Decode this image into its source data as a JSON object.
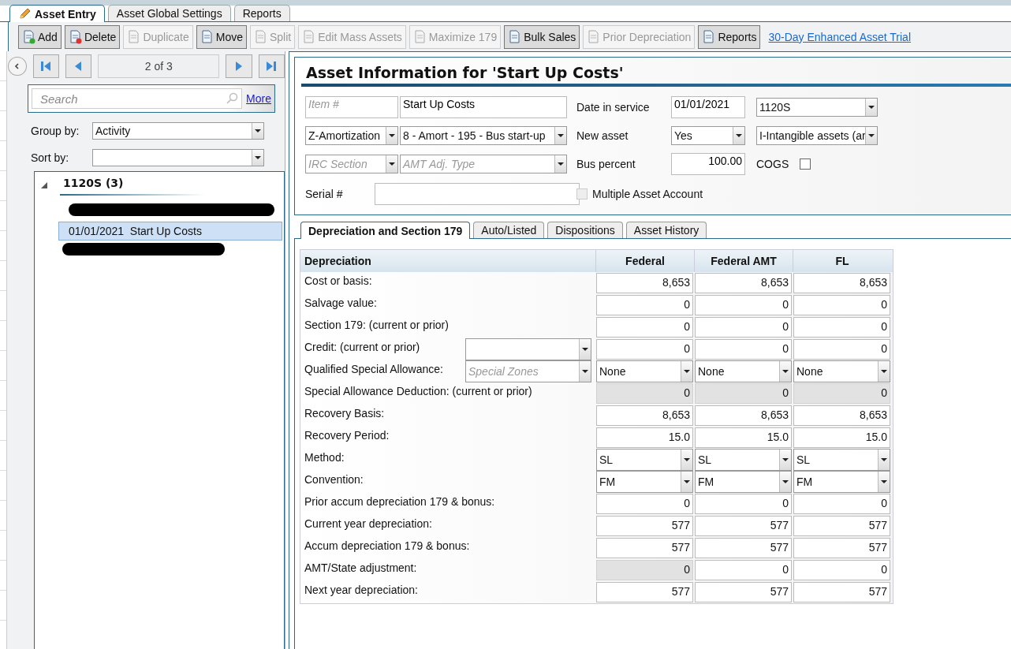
{
  "main_tabs": [
    {
      "label": "Asset Entry",
      "selected": true,
      "icon": true
    },
    {
      "label": "Asset Global Settings",
      "selected": false,
      "icon": false
    },
    {
      "label": "Reports",
      "selected": false,
      "icon": false
    }
  ],
  "toolbar": [
    {
      "label": "Add",
      "disabled": false,
      "pressed": true
    },
    {
      "label": "Delete",
      "disabled": false,
      "pressed": true
    },
    {
      "label": "Duplicate",
      "disabled": true,
      "pressed": false
    },
    {
      "label": "Move",
      "disabled": false,
      "pressed": true
    },
    {
      "label": "Split",
      "disabled": true,
      "pressed": false
    },
    {
      "label": "Edit Mass Assets",
      "disabled": true,
      "pressed": false
    },
    {
      "label": "Maximize 179",
      "disabled": true,
      "pressed": false
    },
    {
      "label": "Bulk Sales",
      "disabled": false,
      "pressed": true
    },
    {
      "label": "Prior Depreciation",
      "disabled": true,
      "pressed": false
    },
    {
      "label": "Reports",
      "disabled": false,
      "pressed": true
    }
  ],
  "trial_link": "30-Day Enhanced Asset Trial",
  "navigator": {
    "position": "2 of 3"
  },
  "search": {
    "placeholder": "Search",
    "more_link": "More"
  },
  "group_by": {
    "label": "Group by:",
    "value": "Activity"
  },
  "sort_by": {
    "label": "Sort by:"
  },
  "tree": [
    {
      "label": "1120S (3)",
      "expanded": true,
      "children": [
        {
          "redacted": true
        },
        {
          "label": "01/01/2021  Start Up Costs",
          "selected": true
        },
        {
          "redacted": true
        }
      ]
    }
  ],
  "asset": {
    "title": "Asset Information for 'Start Up Costs'",
    "item_number": {
      "placeholder": "Item #"
    },
    "description": {
      "value": "Start Up Costs"
    },
    "date_in_service": {
      "label": "Date in service",
      "value": "01/01/2021"
    },
    "return_type": {
      "value": "1120S"
    },
    "category": {
      "value": "Z-Amortization"
    },
    "code": {
      "value": "8 - Amort - 195 - Bus start-up"
    },
    "new_asset": {
      "label": "New asset",
      "value": "Yes"
    },
    "asset_type": {
      "value": "I-Intangible assets (ar"
    },
    "irc_section": {
      "placeholder": "IRC Section"
    },
    "amt_adj_type": {
      "placeholder": "AMT Adj. Type"
    },
    "bus_percent": {
      "label": "Bus percent",
      "value": "100.00"
    },
    "cogs": {
      "label": "COGS",
      "checked": false
    },
    "serial": {
      "label": "Serial #"
    },
    "multiple_asset_account": {
      "label": "Multiple Asset Account",
      "checked": false,
      "disabled": true
    }
  },
  "detail_tabs": [
    {
      "label": "Depreciation and Section 179",
      "selected": true
    },
    {
      "label": "Auto/Listed",
      "selected": false
    },
    {
      "label": "Dispositions",
      "selected": false
    },
    {
      "label": "Asset History",
      "selected": false
    }
  ],
  "table": {
    "columns": [
      "Depreciation",
      "Federal",
      "Federal AMT",
      "FL"
    ],
    "rows": [
      {
        "label": "Cost or basis:",
        "kind": "input",
        "cells": [
          {
            "value": "8,653",
            "readonly": false
          },
          {
            "value": "8,653",
            "readonly": false
          },
          {
            "value": "8,653",
            "readonly": false
          }
        ]
      },
      {
        "label": "Salvage value:",
        "kind": "input",
        "cells": [
          {
            "value": "0",
            "readonly": false
          },
          {
            "value": "0",
            "readonly": false
          },
          {
            "value": "0",
            "readonly": false
          }
        ]
      },
      {
        "label": "Section 179: (current or prior)",
        "kind": "input",
        "cells": [
          {
            "value": "0",
            "readonly": false
          },
          {
            "value": "0",
            "readonly": false
          },
          {
            "value": "0",
            "readonly": false
          }
        ]
      },
      {
        "label": "Credit: (current or prior)",
        "kind": "input",
        "extra": {
          "kind": "dropdown"
        },
        "cells": [
          {
            "value": "0",
            "readonly": false
          },
          {
            "value": "0",
            "readonly": false
          },
          {
            "value": "0",
            "readonly": false
          }
        ]
      },
      {
        "label": "Qualified Special Allowance:",
        "kind": "select",
        "extra": {
          "kind": "dropdown",
          "placeholder": "Special Zones"
        },
        "cells": [
          {
            "value": "None"
          },
          {
            "value": "None"
          },
          {
            "value": "None"
          }
        ]
      },
      {
        "label": "Special Allowance Deduction: (current or prior)",
        "kind": "input",
        "cells": [
          {
            "value": "0",
            "readonly": true
          },
          {
            "value": "0",
            "readonly": true
          },
          {
            "value": "0",
            "readonly": true
          }
        ]
      },
      {
        "label": "Recovery Basis:",
        "kind": "input",
        "cells": [
          {
            "value": "8,653",
            "readonly": false
          },
          {
            "value": "8,653",
            "readonly": false
          },
          {
            "value": "8,653",
            "readonly": false
          }
        ]
      },
      {
        "label": "Recovery Period:",
        "kind": "input",
        "cells": [
          {
            "value": "15.0",
            "readonly": false
          },
          {
            "value": "15.0",
            "readonly": false
          },
          {
            "value": "15.0",
            "readonly": false
          }
        ]
      },
      {
        "label": "Method:",
        "kind": "select",
        "cells": [
          {
            "value": "SL"
          },
          {
            "value": "SL"
          },
          {
            "value": "SL"
          }
        ]
      },
      {
        "label": "Convention:",
        "kind": "select",
        "cells": [
          {
            "value": "FM"
          },
          {
            "value": "FM"
          },
          {
            "value": "FM"
          }
        ]
      },
      {
        "label": "Prior accum depreciation 179 & bonus:",
        "kind": "input",
        "cells": [
          {
            "value": "0",
            "readonly": false
          },
          {
            "value": "0",
            "readonly": false
          },
          {
            "value": "0",
            "readonly": false
          }
        ]
      },
      {
        "label": "Current year depreciation:",
        "kind": "input",
        "cells": [
          {
            "value": "577",
            "readonly": false
          },
          {
            "value": "577",
            "readonly": false
          },
          {
            "value": "577",
            "readonly": false
          }
        ]
      },
      {
        "label": "Accum depreciation 179 & bonus:",
        "kind": "input",
        "cells": [
          {
            "value": "577",
            "readonly": false
          },
          {
            "value": "577",
            "readonly": false
          },
          {
            "value": "577",
            "readonly": false
          }
        ]
      },
      {
        "label": "AMT/State adjustment:",
        "kind": "input",
        "cells": [
          {
            "value": "0",
            "readonly": true
          },
          {
            "value": "0",
            "readonly": false
          },
          {
            "value": "0",
            "readonly": false
          }
        ]
      },
      {
        "label": "Next year depreciation:",
        "kind": "input",
        "cells": [
          {
            "value": "577",
            "readonly": false
          },
          {
            "value": "577",
            "readonly": false
          },
          {
            "value": "577",
            "readonly": false
          }
        ]
      }
    ]
  }
}
